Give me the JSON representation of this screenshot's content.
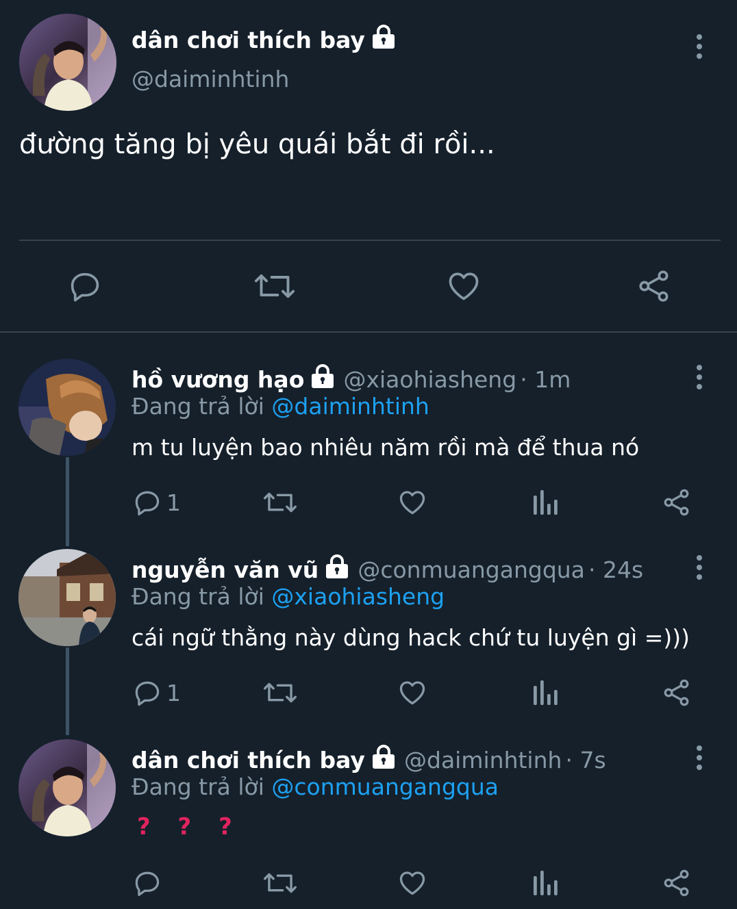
{
  "main_tweet": {
    "display_name": "dân chơi thích bay",
    "handle": "@daiminhtinh",
    "text": "đường tăng bị yêu quái bắt đi rồi..."
  },
  "replies": [
    {
      "display_name": "hồ vương hạo",
      "handle": "@xiaohiasheng",
      "time": "· 1m",
      "replying_prefix": "Đang trả lời",
      "replying_to": "@daiminhtinh",
      "text": "m tu luyện bao nhiêu năm rồi mà để thua nó",
      "reply_count": "1"
    },
    {
      "display_name": "nguyễn văn vũ",
      "handle": "@conmuangangqua",
      "time": "· 24s",
      "replying_prefix": "Đang trả lời",
      "replying_to": "@xiaohiasheng",
      "text": "cái ngữ thằng này dùng hack chứ tu luyện gì =)))",
      "reply_count": "1"
    },
    {
      "display_name": "dân chơi thích bay",
      "handle": "@daiminhtinh",
      "time": "· 7s",
      "replying_prefix": "Đang trả lời",
      "replying_to": "@conmuangangqua",
      "text": "? ? ?",
      "reply_count": ""
    }
  ],
  "icons": {
    "lock": "lock-icon",
    "more": "more-vertical-icon",
    "reply": "reply-icon",
    "retweet": "retweet-icon",
    "like": "heart-icon",
    "analytics": "analytics-icon",
    "share": "share-icon"
  },
  "colors": {
    "background": "#15202b",
    "secondary_text": "#8899a6",
    "mention": "#1da1f2",
    "divider": "#38444d"
  }
}
